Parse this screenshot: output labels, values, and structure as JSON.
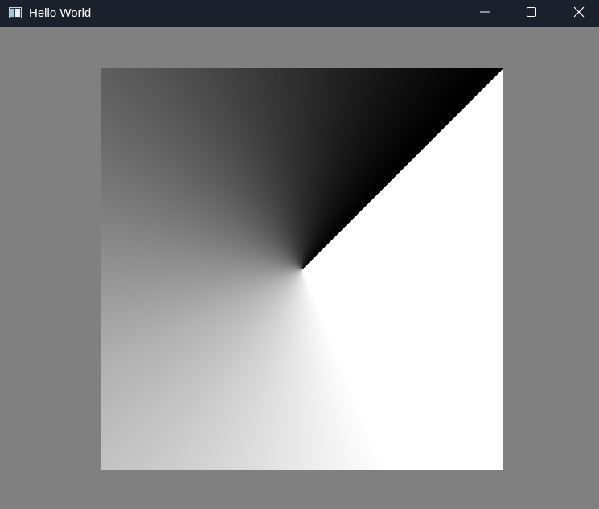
{
  "window": {
    "title": "Hello World",
    "controls": {
      "minimize": "minimize-icon",
      "maximize": "maximize-icon",
      "close": "close-icon"
    },
    "colors": {
      "titlebar": "#1b212c",
      "background": "#808080"
    }
  },
  "canvas": {
    "content": "conic-gradient"
  }
}
